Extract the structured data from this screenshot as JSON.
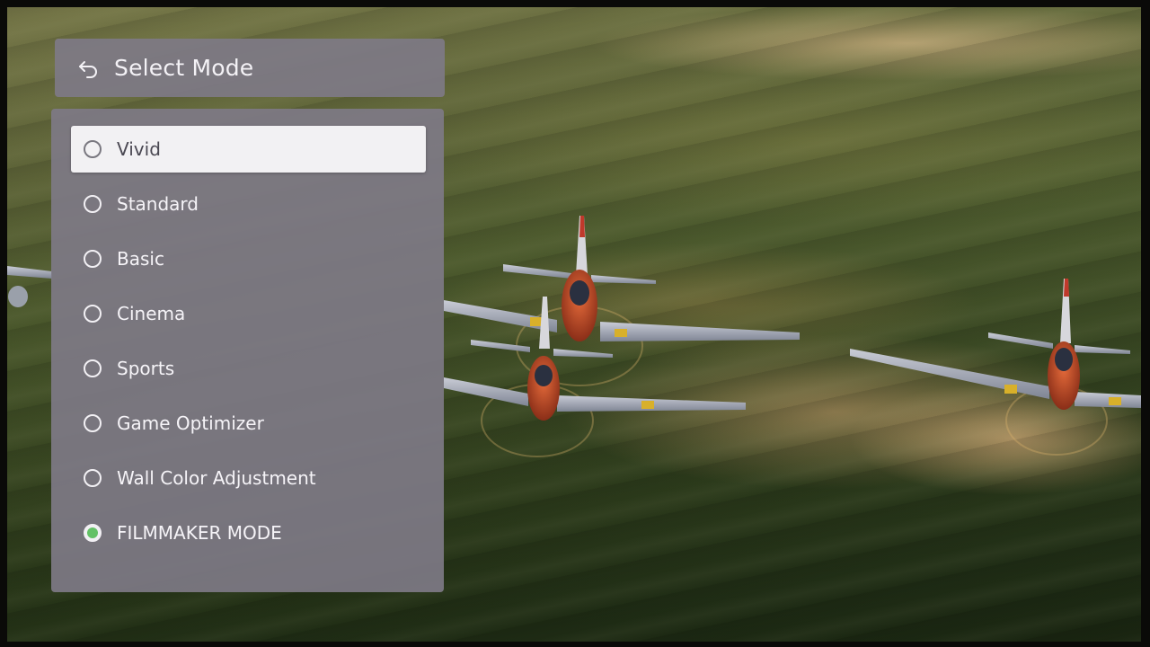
{
  "menu": {
    "title": "Select Mode",
    "back_icon": "back-arrow-icon",
    "modes": [
      {
        "label": "Vivid",
        "focused": true,
        "selected": false
      },
      {
        "label": "Standard",
        "focused": false,
        "selected": false
      },
      {
        "label": "Basic",
        "focused": false,
        "selected": false
      },
      {
        "label": "Cinema",
        "focused": false,
        "selected": false
      },
      {
        "label": "Sports",
        "focused": false,
        "selected": false
      },
      {
        "label": "Game Optimizer",
        "focused": false,
        "selected": false
      },
      {
        "label": "Wall Color Adjustment",
        "focused": false,
        "selected": false
      },
      {
        "label": "FILMMAKER MODE",
        "focused": false,
        "selected": true
      }
    ]
  },
  "colors": {
    "panel": "#7e7a86",
    "focus_highlight": "#f2f1f3",
    "selected_indicator": "#63c166"
  }
}
